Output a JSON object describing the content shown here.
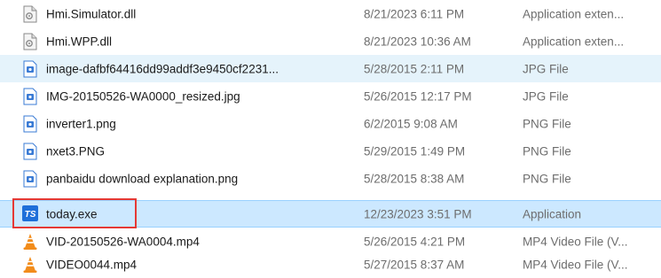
{
  "files": [
    {
      "name": "Hmi.Simulator.dll",
      "date": "8/21/2023 6:11 PM",
      "type": "Application exten...",
      "icon": "dll-file-icon",
      "state": "normal"
    },
    {
      "name": "Hmi.WPP.dll",
      "date": "8/21/2023 10:36 AM",
      "type": "Application exten...",
      "icon": "dll-file-icon",
      "state": "normal"
    },
    {
      "name": "image-dafbf64416dd99addf3e9450cf2231...",
      "date": "5/28/2015 2:11 PM",
      "type": "JPG File",
      "icon": "image-file-icon",
      "state": "hover"
    },
    {
      "name": "IMG-20150526-WA0000_resized.jpg",
      "date": "5/26/2015 12:17 PM",
      "type": "JPG File",
      "icon": "image-file-icon",
      "state": "normal"
    },
    {
      "name": "inverter1.png",
      "date": "6/2/2015 9:08 AM",
      "type": "PNG File",
      "icon": "image-file-icon",
      "state": "normal"
    },
    {
      "name": "nxet3.PNG",
      "date": "5/29/2015 1:49 PM",
      "type": "PNG File",
      "icon": "image-file-icon",
      "state": "normal"
    },
    {
      "name": "panbaidu download explanation.png",
      "date": "5/28/2015 8:38 AM",
      "type": "PNG File",
      "icon": "image-file-icon",
      "state": "normal"
    },
    {
      "name": "today.exe",
      "date": "12/23/2023 3:51 PM",
      "type": "Application",
      "icon": "ts-app-icon",
      "state": "selected"
    },
    {
      "name": "VID-20150526-WA0004.mp4",
      "date": "5/26/2015 4:21 PM",
      "type": "MP4 Video File (V...",
      "icon": "vlc-cone-icon",
      "state": "normal"
    },
    {
      "name": "VIDEO0044.mp4",
      "date": "5/27/2015 8:37 AM",
      "type": "MP4 Video File (V...",
      "icon": "vlc-cone-icon",
      "state": "normal"
    }
  ],
  "colors": {
    "hover_bg": "#e5f3fb",
    "selected_bg": "#cce8ff",
    "highlight_border": "#e53935",
    "ts_icon_bg": "#1e6fd9",
    "vlc_orange": "#f28c1b"
  }
}
